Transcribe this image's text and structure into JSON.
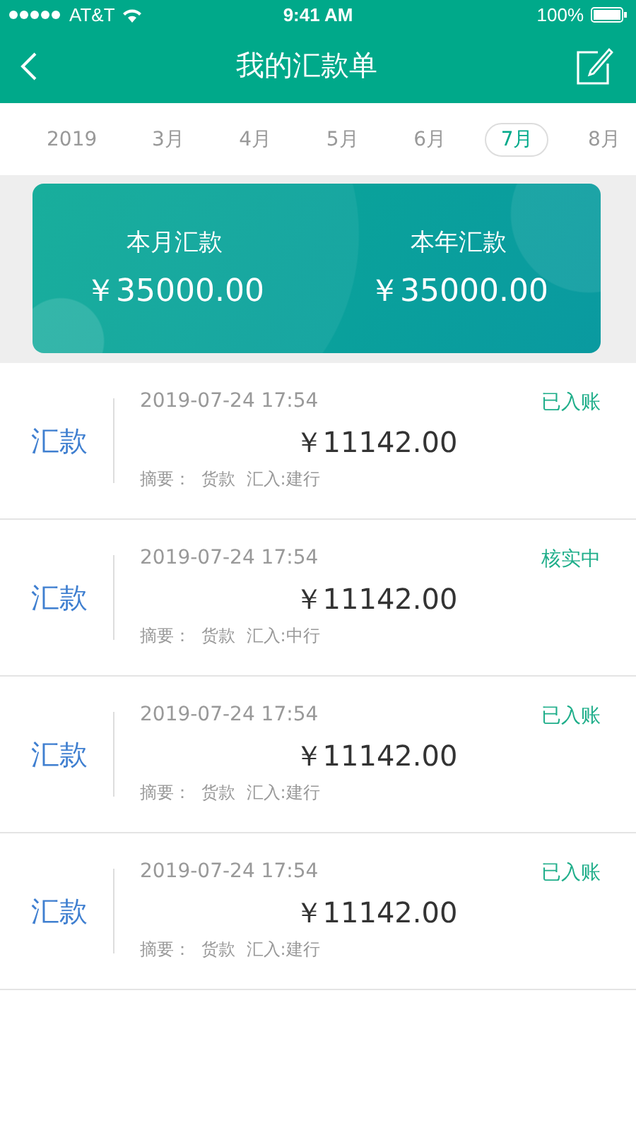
{
  "status_bar": {
    "carrier": "AT&T",
    "time": "9:41 AM",
    "battery": "100%"
  },
  "nav": {
    "title": "我的汇款单"
  },
  "months": [
    {
      "label": "2019",
      "selected": false
    },
    {
      "label": "3月",
      "selected": false
    },
    {
      "label": "4月",
      "selected": false
    },
    {
      "label": "5月",
      "selected": false
    },
    {
      "label": "6月",
      "selected": false
    },
    {
      "label": "7月",
      "selected": true
    },
    {
      "label": "8月",
      "selected": false
    }
  ],
  "summary": [
    {
      "label": "本月汇款",
      "amount": "￥35000.00"
    },
    {
      "label": "本年汇款",
      "amount": "￥35000.00"
    }
  ],
  "records": [
    {
      "type": "汇款",
      "time": "2019-07-24 17:54",
      "status": "已入账",
      "amount": "￥11142.00",
      "note": "摘要：  货款  汇入:建行"
    },
    {
      "type": "汇款",
      "time": "2019-07-24 17:54",
      "status": "核实中",
      "amount": "￥11142.00",
      "note": "摘要：  货款  汇入:中行"
    },
    {
      "type": "汇款",
      "time": "2019-07-24 17:54",
      "status": "已入账",
      "amount": "￥11142.00",
      "note": "摘要：  货款  汇入:建行"
    },
    {
      "type": "汇款",
      "time": "2019-07-24 17:54",
      "status": "已入账",
      "amount": "￥11142.00",
      "note": "摘要：  货款  汇入:建行"
    }
  ]
}
